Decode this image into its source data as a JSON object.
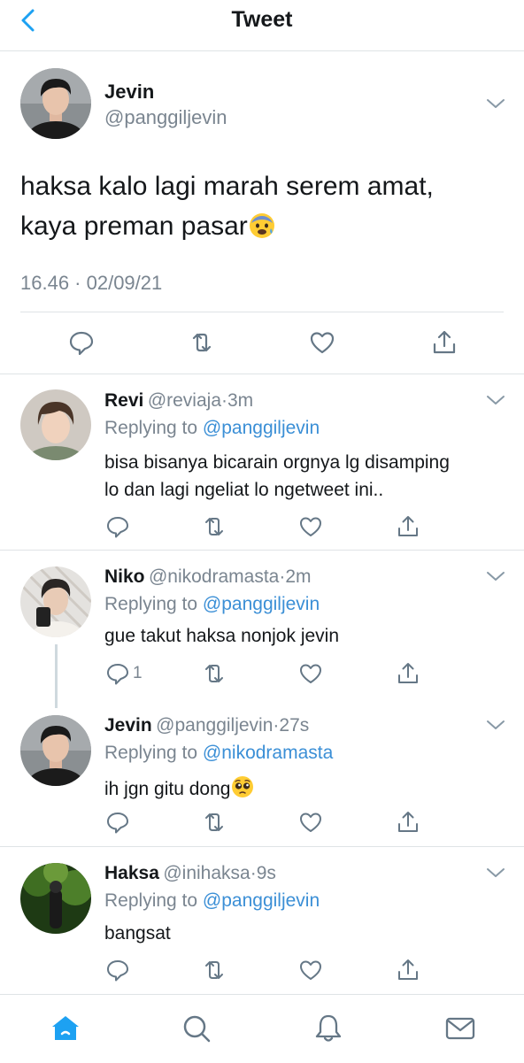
{
  "header": {
    "title": "Tweet",
    "back_icon": "chevron-left-icon"
  },
  "main_tweet": {
    "name": "Jevin",
    "handle": "@panggiljevin",
    "text_line1": "haksa kalo lagi marah serem amat,",
    "text_line2": "kaya preman pasar",
    "emoji": "anxious-face-emoji",
    "timestamp": "16.46 · 02/09/21"
  },
  "replies": [
    {
      "name": "Revi",
      "handle": "@reviaja",
      "time": "3m",
      "replying_label": "Replying to",
      "replying_to": "@panggiljevin",
      "text_line1": "bisa bisanya bicarain orgnya lg disamping",
      "text_line2": "lo dan lagi ngeliat lo ngetweet ini..",
      "reply_count": ""
    },
    {
      "name": "Niko",
      "handle": "@nikodramasta",
      "time": "2m",
      "replying_label": "Replying to",
      "replying_to": "@panggiljevin",
      "text_line1": "gue takut haksa nonjok jevin",
      "reply_count": "1"
    },
    {
      "name": "Jevin",
      "handle": "@panggiljevin",
      "time": "27s",
      "replying_label": "Replying to",
      "replying_to": "@nikodramasta",
      "text_line1": "ih jgn gitu dong",
      "emoji": "pleading-face-emoji",
      "reply_count": ""
    },
    {
      "name": "Haksa",
      "handle": "@inihaksa",
      "time": "9s",
      "replying_label": "Replying to",
      "replying_to": "@panggiljevin",
      "text_line1": "bangsat",
      "reply_count": ""
    }
  ],
  "tab_bar": {
    "items": [
      "home-icon",
      "search-icon",
      "notifications-icon",
      "messages-icon"
    ],
    "active": "home-icon"
  },
  "colors": {
    "accent": "#1da1f2",
    "link": "#3b8fd6",
    "muted": "#7a8590",
    "divider": "#dfe3e6"
  }
}
